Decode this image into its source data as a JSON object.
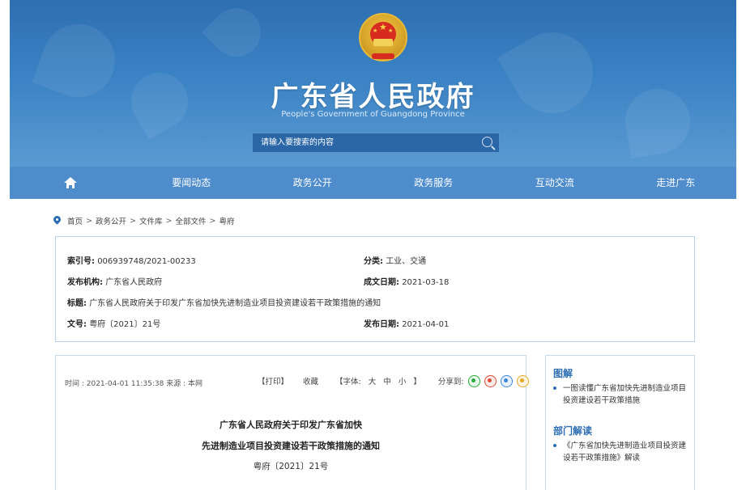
{
  "header": {
    "site_title": "广东省人民政府",
    "site_subtitle": "People's Government of Guangdong Province",
    "search_placeholder": "请输入要搜索的内容"
  },
  "nav": {
    "items": [
      "要闻动态",
      "政务公开",
      "政务服务",
      "互动交流",
      "走进广东"
    ]
  },
  "breadcrumb": [
    "首页",
    "政务公开",
    "文件库",
    "全部文件",
    "粤府"
  ],
  "info": {
    "index_label": "索引号:",
    "index_value": "006939748/2021-00233",
    "category_label": "分类:",
    "category_value": "工业、交通",
    "issuer_label": "发布机构:",
    "issuer_value": "广东省人民政府",
    "created_label": "成文日期:",
    "created_value": "2021-03-18",
    "title_label": "标题:",
    "title_value": "广东省人民政府关于印发广东省加快先进制造业项目投资建设若干政策措施的通知",
    "docno_label": "文号:",
    "docno_value": "粤府〔2021〕21号",
    "published_label": "发布日期:",
    "published_value": "2021-04-01"
  },
  "article": {
    "meta": "时间 : 2021-04-01 11:35:38   来源 : 本网",
    "print_label": "【打印】",
    "favorite_label": "收藏",
    "font_prefix": "【字体:",
    "font_large": "大",
    "font_medium": "中",
    "font_small": "小",
    "font_suffix": "】",
    "share_label": "分享到:",
    "title_line1": "广东省人民政府关于印发广东省加快",
    "title_line2": "先进制造业项目投资建设若干政策措施的通知",
    "doc_number": "粤府〔2021〕21号"
  },
  "sidebar": {
    "section1_title": "图解",
    "section1_item": "一图读懂广东省加快先进制造业项目投资建设若干政策措施",
    "section2_title": "部门解读",
    "section2_item": "《广东省加快先进制造业项目投资建设若干政策措施》解读"
  }
}
